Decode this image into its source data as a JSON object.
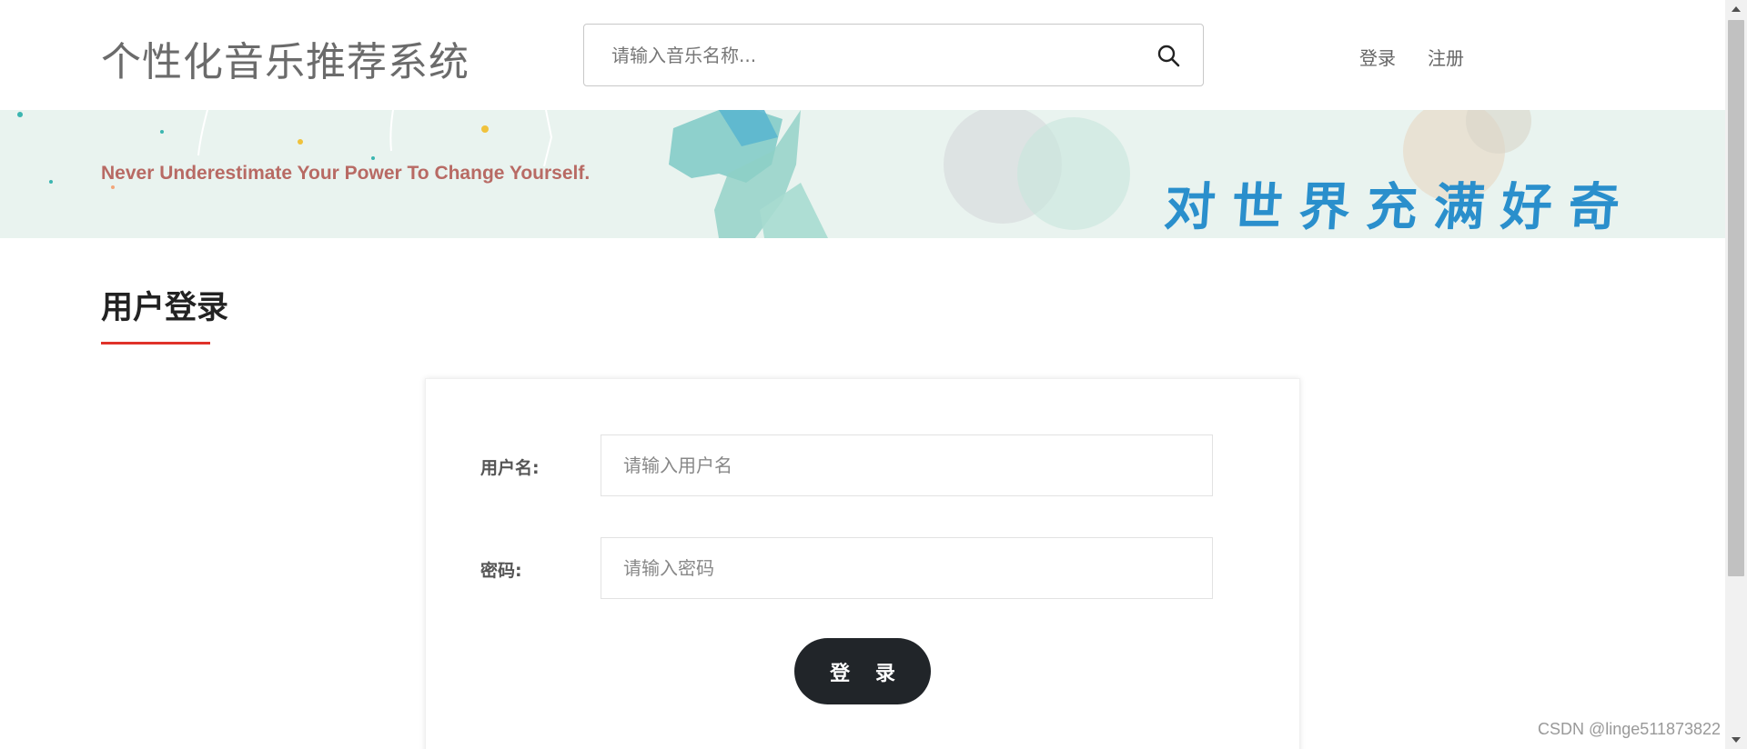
{
  "header": {
    "site_title": "个性化音乐推荐系统",
    "search_placeholder": "请输入音乐名称...",
    "nav": {
      "login": "登录",
      "register": "注册"
    }
  },
  "banner": {
    "motto": "Never Underestimate Your Power To Change Yourself.",
    "slogan": "对世界充满好奇"
  },
  "section": {
    "title": "用户登录"
  },
  "form": {
    "username_label": "用户名:",
    "username_placeholder": "请输入用户名",
    "password_label": "密码:",
    "password_placeholder": "请输入密码",
    "submit_label": "登 录"
  },
  "watermark": "CSDN @linge511873822",
  "colors": {
    "accent_red": "#e0322a",
    "button_dark": "#212529",
    "slogan_blue": "#2a8fcc",
    "motto_rose": "#b86a64",
    "banner_bg": "#e9f3ef"
  }
}
